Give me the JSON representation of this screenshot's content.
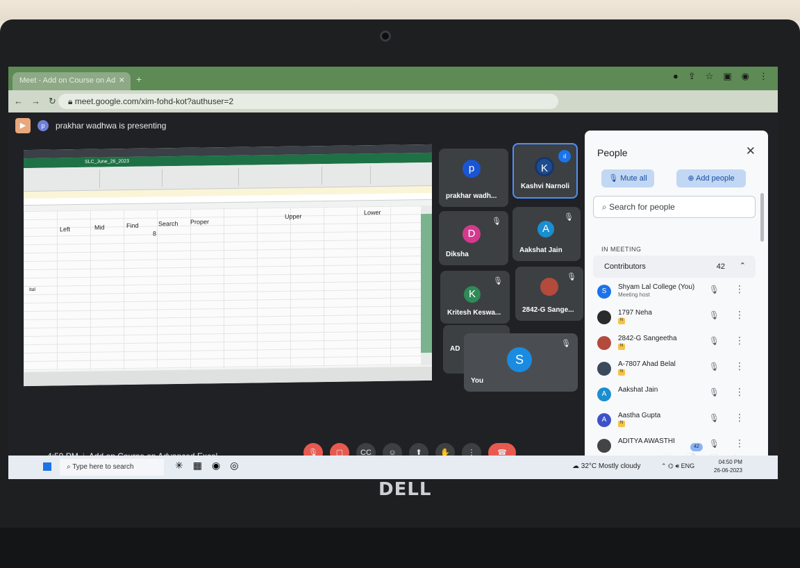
{
  "browser": {
    "tab_title": "Meet - Add on Course on Ad",
    "url": "meet.google.com/xim-fohd-kot?authuser=2"
  },
  "meet": {
    "presenter_initial": "p",
    "presenting_text": "prakhar wadhwa is presenting",
    "time": "4:50 PM",
    "separator": "|",
    "meeting_name": "Add on Course on Advanced Excel",
    "people_count_badge": "42"
  },
  "excel": {
    "document_title": "SLC_June_26_2023",
    "columns": [
      "Left",
      "Mid",
      "Find",
      "Search",
      "Proper",
      "Upper",
      "Lower"
    ],
    "cell_value": "8",
    "row_label": "ital"
  },
  "tiles": [
    {
      "initial": "p",
      "name": "prakhar wadh...",
      "color": "#1a55d6"
    },
    {
      "initial": "K",
      "name": "Kashvi Narnoli",
      "color": "#1d4c8f"
    },
    {
      "initial": "D",
      "name": "Diksha",
      "color": "#d33a8d"
    },
    {
      "initial": "A",
      "name": "Aakshat Jain",
      "color": "#1a8ecf"
    },
    {
      "initial": "K",
      "name": "Kritesh Keswa...",
      "color": "#2e8b57"
    },
    {
      "initial": "",
      "name": "2842-G Sange...",
      "color": "#b34a3c"
    },
    {
      "initial": "",
      "name": "AD",
      "color": "#3c4043"
    },
    {
      "initial": "S",
      "name": "You",
      "color": "#1a8be0"
    }
  ],
  "people_panel": {
    "title": "People",
    "mute_all": "Mute all",
    "add_people": "Add people",
    "search_placeholder": "Search for people",
    "section_label": "IN MEETING",
    "group_label": "Contributors",
    "group_count": "42",
    "participants": [
      {
        "initial": "S",
        "name": "Shyam Lal College (You)",
        "sub": "Meeting host",
        "color": "#1a73e8"
      },
      {
        "initial": "",
        "name": "1797 Neha",
        "sub": "",
        "color": "#2b2b2b"
      },
      {
        "initial": "",
        "name": "2842-G Sangeetha",
        "sub": "",
        "color": "#b34a3c"
      },
      {
        "initial": "",
        "name": "A-7807 Ahad Belal",
        "sub": "",
        "color": "#3b4a5a"
      },
      {
        "initial": "A",
        "name": "Aakshat Jain",
        "sub": "",
        "color": "#1a8ecf"
      },
      {
        "initial": "A",
        "name": "Aastha Gupta",
        "sub": "",
        "color": "#3d52c9"
      },
      {
        "initial": "",
        "name": "ADITYA AWASTHI",
        "sub": "",
        "color": "#444"
      }
    ]
  },
  "taskbar": {
    "search_placeholder": "Type here to search",
    "weather": "32°C Mostly cloudy",
    "lang": "ENG",
    "clock_time": "04:50 PM",
    "clock_date": "26-06-2023"
  },
  "laptop": {
    "brand": "DELL"
  }
}
